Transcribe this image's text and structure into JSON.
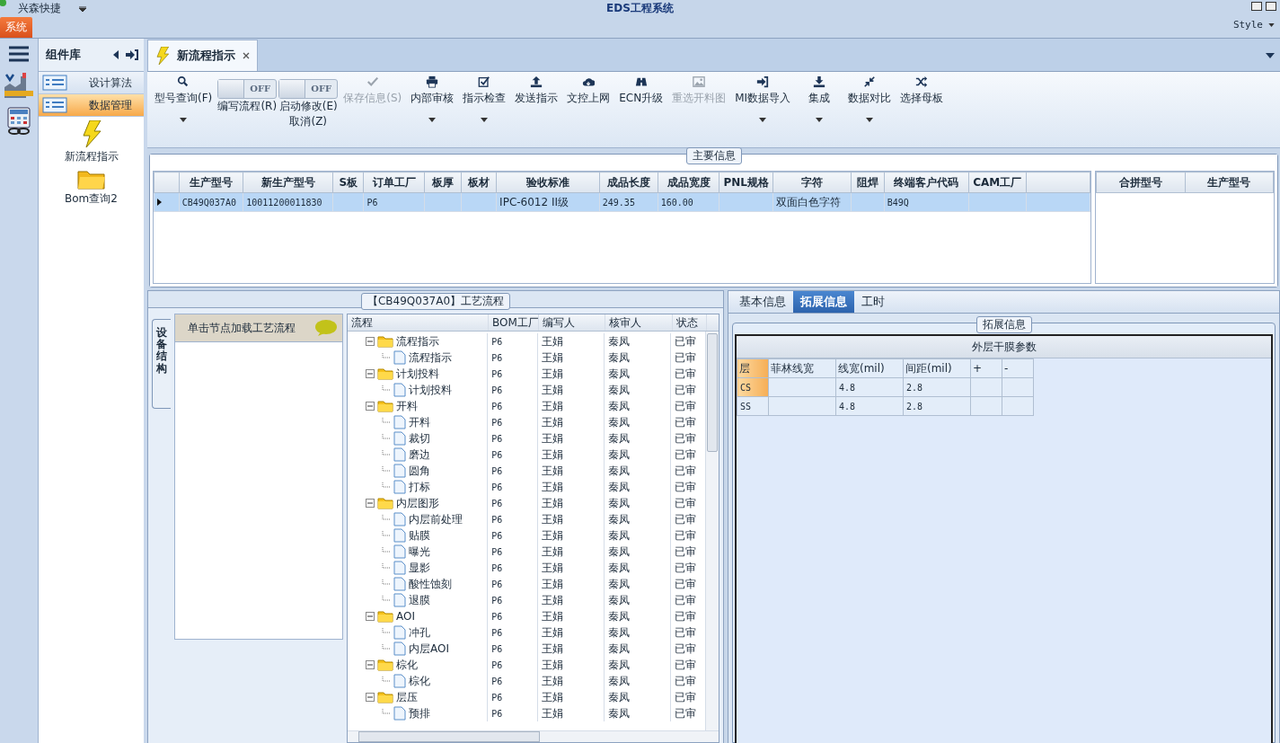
{
  "app": {
    "title": "兴森快捷",
    "window_title": "EDS工程系统",
    "menu_tab": "系统",
    "style_menu": "Style"
  },
  "sidebar": {
    "title": "组件库",
    "items": [
      {
        "label": "设计算法",
        "selected": false
      },
      {
        "label": "数据管理",
        "selected": true
      }
    ],
    "shortcuts": [
      {
        "label": "新流程指示",
        "kind": "bolt"
      },
      {
        "label": "Bom查询2",
        "kind": "folder"
      }
    ]
  },
  "doc_tab": {
    "label": "新流程指示"
  },
  "toolbar": [
    {
      "kind": "button",
      "label": "型号查询(F)",
      "dropdown": true,
      "disabled": false
    },
    {
      "kind": "toggle",
      "label": "编写流程(R)",
      "switch_text": "OFF",
      "on": false
    },
    {
      "kind": "toggle",
      "label": "启动修改(E)",
      "sublabel": "取消(Z)",
      "switch_text": "OFF",
      "on": false
    },
    {
      "kind": "button",
      "label": "保存信息(S)",
      "dropdown": false,
      "disabled": true
    },
    {
      "kind": "button",
      "label": "内部审核",
      "dropdown": true,
      "disabled": false
    },
    {
      "kind": "button",
      "label": "指示检查",
      "dropdown": true,
      "disabled": false
    },
    {
      "kind": "button",
      "label": "发送指示",
      "dropdown": false,
      "disabled": false
    },
    {
      "kind": "button",
      "label": "文控上网",
      "dropdown": false,
      "disabled": false
    },
    {
      "kind": "button",
      "label": "ECN升级",
      "dropdown": false,
      "disabled": false
    },
    {
      "kind": "button",
      "label": "重选开料图",
      "dropdown": false,
      "disabled": true
    },
    {
      "kind": "button",
      "label": "MI数据导入",
      "dropdown": true,
      "disabled": false
    },
    {
      "kind": "button",
      "label": "集成",
      "dropdown": true,
      "disabled": false
    },
    {
      "kind": "button",
      "label": "数据对比",
      "dropdown": true,
      "disabled": false
    },
    {
      "kind": "button",
      "label": "选择母板",
      "dropdown": false,
      "disabled": false
    }
  ],
  "main_info": {
    "title": "主要信息",
    "columns": [
      "生产型号",
      "新生产型号",
      "S板",
      "订单工厂",
      "板厚",
      "板材",
      "验收标准",
      "成品长度",
      "成品宽度",
      "PNL规格",
      "字符",
      "阻焊",
      "终端客户代码",
      "CAM工厂"
    ],
    "rows": [
      {
        "selected": true,
        "cells": [
          "CB49Q037A0",
          "10011200011830",
          "",
          "P6",
          "",
          "",
          "IPC-6012 II级",
          "249.35",
          "160.00",
          "",
          "双面白色字符",
          "",
          "B49Q",
          ""
        ]
      }
    ],
    "side_columns": [
      "合拼型号",
      "生产型号"
    ]
  },
  "process": {
    "title": "【CB49Q037A0】工艺流程",
    "side_tab": "设备结构",
    "hint": "单击节点加载工艺流程",
    "columns": [
      "流程",
      "BOM工厂",
      "编写人",
      "核审人",
      "状态"
    ],
    "nodes": [
      {
        "label": "流程指示",
        "bom": "P6",
        "author": "王娟",
        "reviewer": "秦凤",
        "status": "已审",
        "expanded": true,
        "children": [
          {
            "label": "流程指示",
            "bom": "P6",
            "author": "王娟",
            "reviewer": "秦凤",
            "status": "已审"
          }
        ]
      },
      {
        "label": "计划投料",
        "bom": "P6",
        "author": "王娟",
        "reviewer": "秦凤",
        "status": "已审",
        "expanded": true,
        "children": [
          {
            "label": "计划投料",
            "bom": "P6",
            "author": "王娟",
            "reviewer": "秦凤",
            "status": "已审"
          }
        ]
      },
      {
        "label": "开料",
        "bom": "P6",
        "author": "王娟",
        "reviewer": "秦凤",
        "status": "已审",
        "expanded": true,
        "children": [
          {
            "label": "开料",
            "bom": "P6",
            "author": "王娟",
            "reviewer": "秦凤",
            "status": "已审"
          },
          {
            "label": "裁切",
            "bom": "P6",
            "author": "王娟",
            "reviewer": "秦凤",
            "status": "已审"
          },
          {
            "label": "磨边",
            "bom": "P6",
            "author": "王娟",
            "reviewer": "秦凤",
            "status": "已审"
          },
          {
            "label": "圆角",
            "bom": "P6",
            "author": "王娟",
            "reviewer": "秦凤",
            "status": "已审"
          },
          {
            "label": "打标",
            "bom": "P6",
            "author": "王娟",
            "reviewer": "秦凤",
            "status": "已审"
          }
        ]
      },
      {
        "label": "内层图形",
        "bom": "P6",
        "author": "王娟",
        "reviewer": "秦凤",
        "status": "已审",
        "expanded": true,
        "children": [
          {
            "label": "内层前处理",
            "bom": "P6",
            "author": "王娟",
            "reviewer": "秦凤",
            "status": "已审"
          },
          {
            "label": "贴膜",
            "bom": "P6",
            "author": "王娟",
            "reviewer": "秦凤",
            "status": "已审"
          },
          {
            "label": "曝光",
            "bom": "P6",
            "author": "王娟",
            "reviewer": "秦凤",
            "status": "已审"
          },
          {
            "label": "显影",
            "bom": "P6",
            "author": "王娟",
            "reviewer": "秦凤",
            "status": "已审"
          },
          {
            "label": "酸性蚀刻",
            "bom": "P6",
            "author": "王娟",
            "reviewer": "秦凤",
            "status": "已审"
          },
          {
            "label": "退膜",
            "bom": "P6",
            "author": "王娟",
            "reviewer": "秦凤",
            "status": "已审"
          }
        ]
      },
      {
        "label": "AOI",
        "bom": "P6",
        "author": "王娟",
        "reviewer": "秦凤",
        "status": "已审",
        "expanded": true,
        "children": [
          {
            "label": "冲孔",
            "bom": "P6",
            "author": "王娟",
            "reviewer": "秦凤",
            "status": "已审"
          },
          {
            "label": "内层AOI",
            "bom": "P6",
            "author": "王娟",
            "reviewer": "秦凤",
            "status": "已审"
          }
        ]
      },
      {
        "label": "棕化",
        "bom": "P6",
        "author": "王娟",
        "reviewer": "秦凤",
        "status": "已审",
        "expanded": true,
        "children": [
          {
            "label": "棕化",
            "bom": "P6",
            "author": "王娟",
            "reviewer": "秦凤",
            "status": "已审"
          }
        ]
      },
      {
        "label": "层压",
        "bom": "P6",
        "author": "王娟",
        "reviewer": "秦凤",
        "status": "已审",
        "expanded": true,
        "children": [
          {
            "label": "预排",
            "bom": "P6",
            "author": "王娟",
            "reviewer": "秦凤",
            "status": "已审"
          }
        ]
      }
    ]
  },
  "details": {
    "tabs": [
      {
        "label": "基本信息",
        "selected": false
      },
      {
        "label": "拓展信息",
        "selected": true
      },
      {
        "label": "工时",
        "selected": false
      }
    ],
    "group_title": "拓展信息",
    "table_title": "外层干膜参数",
    "columns": [
      "层",
      "菲林线宽",
      "线宽(mil)",
      "间距(mil)",
      "+",
      "-"
    ],
    "rows": [
      {
        "selected": true,
        "cells": [
          "CS",
          "",
          "4.8",
          "2.8",
          "",
          ""
        ]
      },
      {
        "selected": false,
        "cells": [
          "SS",
          "",
          "4.8",
          "2.8",
          "",
          ""
        ]
      }
    ]
  }
}
